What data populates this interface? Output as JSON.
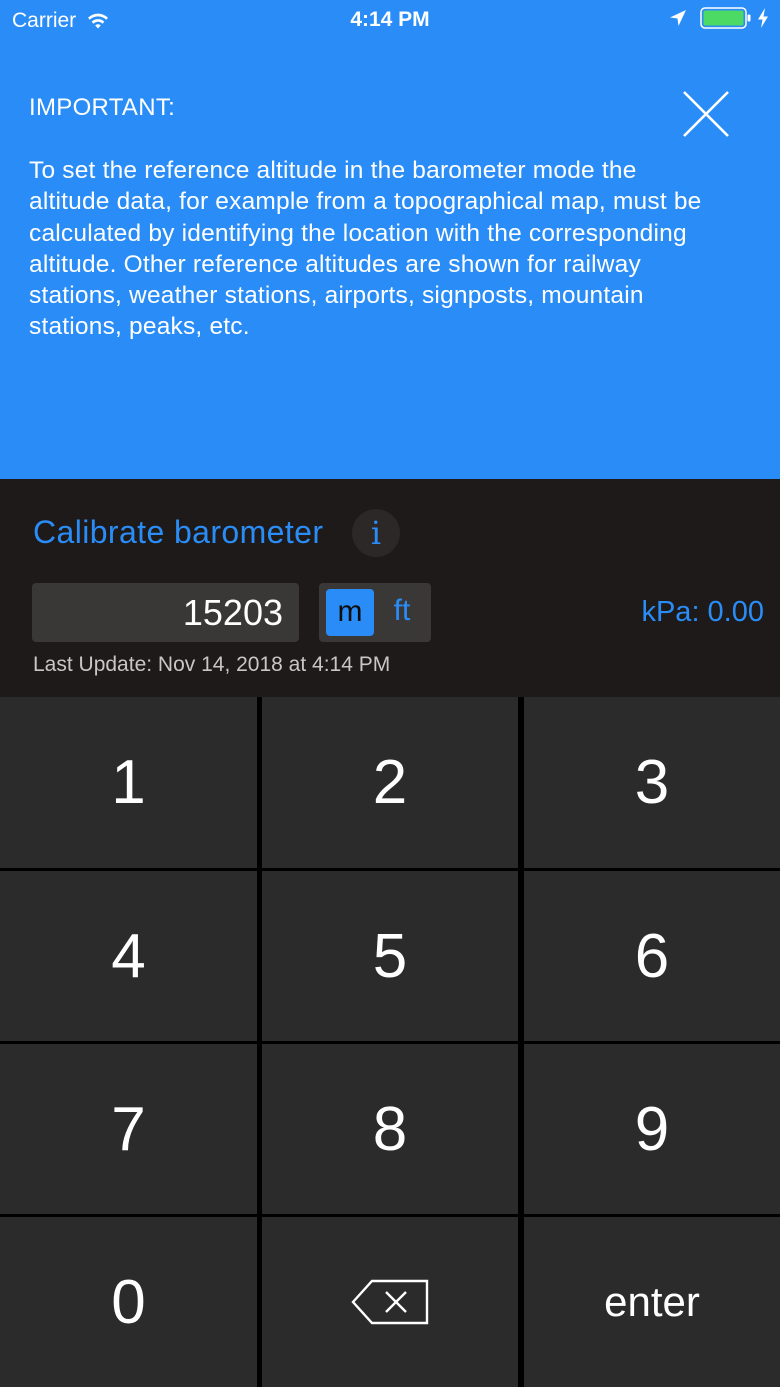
{
  "status_bar": {
    "carrier": "Carrier",
    "time": "4:14 PM"
  },
  "info": {
    "heading": "IMPORTANT:",
    "body": "To set the reference altitude in the barometer mode the altitude data, for example from a topographical map, must be calculated by identifying the location with the corresponding altitude. Other reference altitudes are shown for railway stations, weather stations, airports, signposts, mountain stations, peaks, etc."
  },
  "calibrate": {
    "title": "Calibrate barometer",
    "info_glyph": "i",
    "altitude_value": "15203",
    "unit_m": "m",
    "unit_ft": "ft",
    "selected_unit": "m",
    "kpa": "kPa: 0.00",
    "last_update": "Last Update:  Nov 14, 2018 at 4:14 PM"
  },
  "keypad": {
    "keys": [
      "1",
      "2",
      "3",
      "4",
      "5",
      "6",
      "7",
      "8",
      "9",
      "0",
      "",
      "enter"
    ]
  },
  "icons": {
    "close": "close-icon",
    "info": "info-icon",
    "backspace": "backspace-icon",
    "wifi": "wifi-icon",
    "location": "location-arrow-icon",
    "battery": "battery-icon"
  },
  "colors": {
    "accent": "#2a8df7",
    "panel_dark": "#1d1a19",
    "key_bg": "#2b2b2b",
    "battery_green": "#4cd964"
  }
}
